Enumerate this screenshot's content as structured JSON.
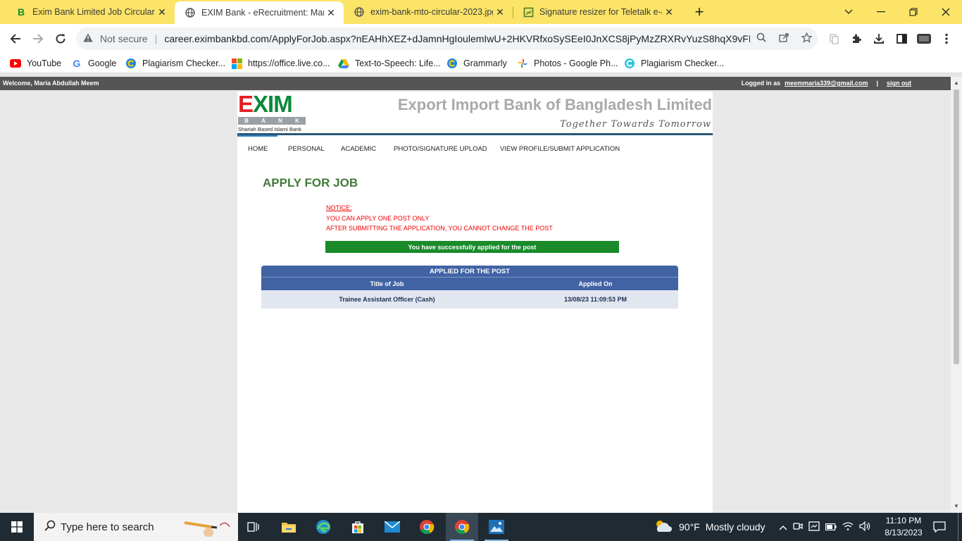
{
  "browser": {
    "tabs": [
      {
        "title": "Exim Bank Limited Job Circular 20",
        "active": false
      },
      {
        "title": "EXIM Bank - eRecruitment: Maria",
        "active": true
      },
      {
        "title": "exim-bank-mto-circular-2023.jpg",
        "active": false
      },
      {
        "title": "Signature resizer for Teletalk e-ap",
        "active": false
      }
    ],
    "new_tab": "+",
    "close_glyph": "✕",
    "address": {
      "security": "Not secure",
      "url": "career.eximbankbd.com/ApplyForJob.aspx?nEAHhXEZ+dJamnHgIoulemIwU+2HKVRfxoSySEeI0JnXCS8jPyMzZRXRvYuzS8hqX9vFFkFB7..."
    },
    "bookmarks": [
      {
        "label": "YouTube",
        "icon": "youtube-icon"
      },
      {
        "label": "Google",
        "icon": "google-icon"
      },
      {
        "label": "Plagiarism Checker...",
        "icon": "plagiarism-icon"
      },
      {
        "label": "https://office.live.co...",
        "icon": "office-icon"
      },
      {
        "label": "Text-to-Speech: Life...",
        "icon": "drive-icon"
      },
      {
        "label": "Grammarly",
        "icon": "grammarly-icon"
      },
      {
        "label": "Photos - Google Ph...",
        "icon": "photos-icon"
      },
      {
        "label": "Plagiarism Checker...",
        "icon": "plagiarism-icon"
      }
    ]
  },
  "site": {
    "userbar": {
      "welcome": "Welcome, Maria Abdullah Meem",
      "logged_in_as": "Logged in as",
      "email": "meemmaria339@gmail.com",
      "divider": "|",
      "sign_out": "sign out"
    },
    "logo": {
      "text_e": "E",
      "text_rest": "XIM",
      "bank_letters": [
        "B",
        "A",
        "N",
        "K"
      ],
      "subtitle": "Shariah Based Islami Bank"
    },
    "bank_name": "Export Import Bank of Bangladesh Limited",
    "tagline": "Together Towards Tomorrow",
    "nav": [
      "HOME",
      "PERSONAL",
      "ACADEMIC",
      "PHOTO/SIGNATURE UPLOAD",
      "VIEW PROFILE/SUBMIT APPLICATION"
    ],
    "page_title": "APPLY FOR JOB",
    "notice": {
      "heading": "NOTICE:",
      "lines": [
        "YOU CAN APPLY ONE POST ONLY",
        "AFTER SUBMITTING THE APPLICATION, YOU CANNOT CHANGE THE POST"
      ]
    },
    "success_message": "You have successfully applied for the post",
    "applied_table": {
      "caption": "APPLIED FOR THE POST",
      "columns": [
        "Title of Job",
        "Applied On"
      ],
      "rows": [
        [
          "Trainee Assistant Officer (Cash)",
          "13/08/23 11:09:53 PM"
        ]
      ]
    }
  },
  "taskbar": {
    "search_placeholder": "Type here to search",
    "weather": {
      "temp": "90°F",
      "condition": "Mostly cloudy"
    },
    "clock": {
      "time": "11:10 PM",
      "date": "8/13/2023"
    }
  },
  "colors": {
    "tabstrip": "#fbe467",
    "exim_red": "#e31e24",
    "exim_green": "#0b8a3a",
    "title_green": "#43793b",
    "notice_red": "#ee0000",
    "success_green": "#1a8a2a",
    "table_blue": "#4163a4"
  }
}
